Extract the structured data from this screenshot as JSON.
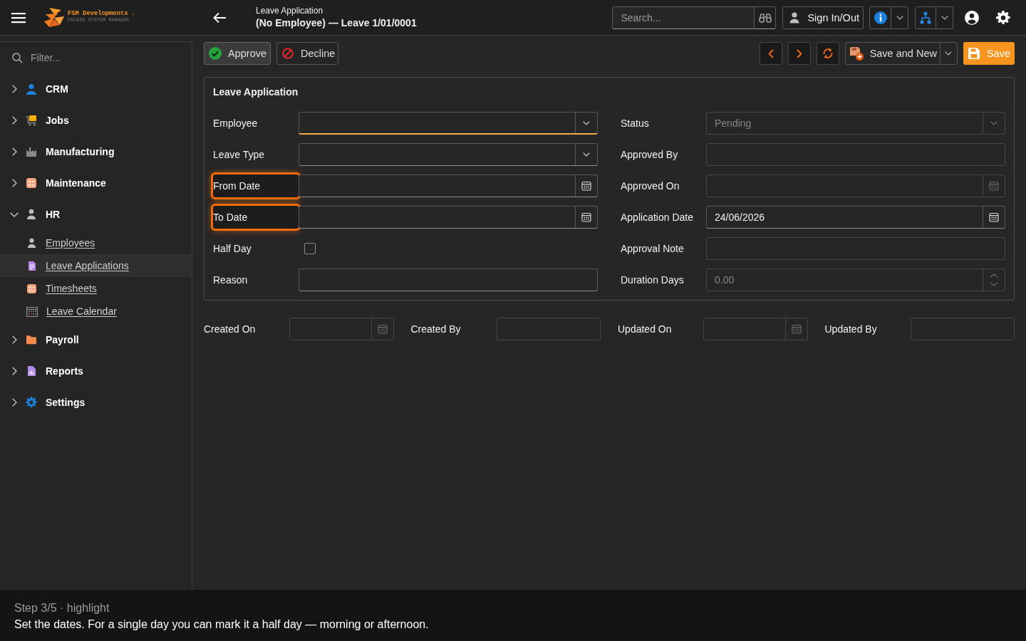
{
  "topbar": {
    "brand": {
      "name": "FSM Developments .",
      "tagline": "FACADE SYSTEM MANAGER"
    },
    "title": "Leave Application",
    "subtitle": "(No Employee) — Leave 1/01/0001",
    "search": {
      "placeholder": "Search..."
    },
    "sign_in_button": "Sign In/Out"
  },
  "sidebar": {
    "filter": {
      "placeholder": "Filter..."
    },
    "items": [
      {
        "label": "CRM",
        "expanded": false
      },
      {
        "label": "Jobs",
        "expanded": false
      },
      {
        "label": "Manufacturing",
        "expanded": false
      },
      {
        "label": "Maintenance",
        "expanded": false
      },
      {
        "label": "HR",
        "expanded": true,
        "children": [
          {
            "label": "Employees",
            "selected": false
          },
          {
            "label": "Leave Applications",
            "selected": true
          },
          {
            "label": "Timesheets",
            "selected": false
          },
          {
            "label": "Leave Calendar",
            "selected": false
          }
        ]
      },
      {
        "label": "Payroll",
        "expanded": false
      },
      {
        "label": "Reports",
        "expanded": false
      },
      {
        "label": "Settings",
        "expanded": false
      }
    ]
  },
  "toolbar": {
    "actions": [
      {
        "kind": "approve",
        "label": "Approve"
      },
      {
        "kind": "decline",
        "label": "Decline"
      }
    ],
    "save_and_new_button": "Save and New",
    "save_button": "Save"
  },
  "form": {
    "title": "Leave Application",
    "left": [
      {
        "label": "Employee",
        "kind": "dropdown",
        "focused": true,
        "disabled": false,
        "highlighted": false
      },
      {
        "label": "Leave Type",
        "kind": "dropdown",
        "focused": false,
        "disabled": false,
        "highlighted": false
      },
      {
        "label": "From Date",
        "kind": "date",
        "focused": false,
        "disabled": false,
        "highlighted": true
      },
      {
        "label": "To Date",
        "kind": "date",
        "focused": false,
        "disabled": false,
        "highlighted": true
      },
      {
        "label": "Half Day",
        "kind": "checkbox",
        "checked": false,
        "focused": false,
        "disabled": false,
        "highlighted": false
      },
      {
        "label": "Reason",
        "kind": "text",
        "focused": false,
        "disabled": false,
        "highlighted": false
      }
    ],
    "right": [
      {
        "label": "Status",
        "kind": "dropdown",
        "value": "Pending",
        "focused": false,
        "disabled": true,
        "highlighted": false
      },
      {
        "label": "Approved By",
        "kind": "text",
        "focused": false,
        "disabled": true,
        "highlighted": false
      },
      {
        "label": "Approved On",
        "kind": "date",
        "focused": false,
        "disabled": true,
        "highlighted": false
      },
      {
        "label": "Application Date",
        "kind": "date",
        "value": "24/06/2026",
        "focused": false,
        "disabled": false,
        "highlighted": false
      },
      {
        "label": "Approval Note",
        "kind": "text",
        "focused": false,
        "disabled": true,
        "highlighted": false
      },
      {
        "label": "Duration Days",
        "kind": "number",
        "value": "0.00",
        "focused": false,
        "disabled": true,
        "highlighted": false
      }
    ]
  },
  "audit": [
    {
      "label": "Created On",
      "kind": "date",
      "disabled": true
    },
    {
      "label": "Created By",
      "kind": "text",
      "disabled": true
    },
    {
      "label": "Updated On",
      "kind": "date",
      "disabled": true
    },
    {
      "label": "Updated By",
      "kind": "text",
      "disabled": true
    }
  ],
  "tour": {
    "step": "Step 3/5 · highlight",
    "message": "Set the dates. For a single day you can mark it a half day — morning or afternoon."
  }
}
